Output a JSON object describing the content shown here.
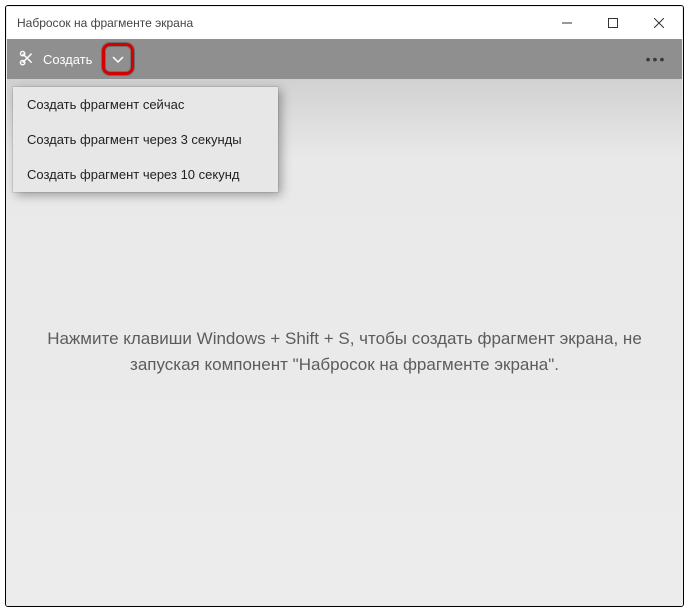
{
  "titlebar": {
    "title": "Набросок на фрагменте экрана"
  },
  "toolbar": {
    "create_label": "Создать"
  },
  "dropdown": {
    "items": [
      {
        "label": "Создать фрагмент сейчас"
      },
      {
        "label": "Создать фрагмент через 3 секунды"
      },
      {
        "label": "Создать фрагмент через 10 секунд"
      }
    ]
  },
  "content": {
    "hint": "Нажмите клавиши Windows + Shift + S, чтобы создать фрагмент экрана, не запуская компонент \"Набросок на фрагменте экрана\"."
  }
}
